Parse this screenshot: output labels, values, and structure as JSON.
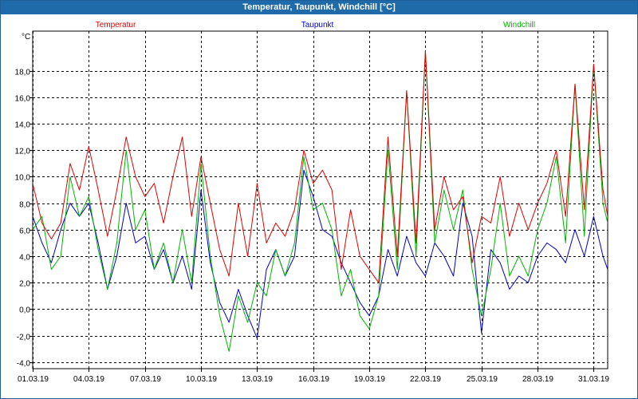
{
  "window": {
    "title": "Temperatur, Taupunkt, Windchill [°C]"
  },
  "chart_data": {
    "type": "line",
    "title": "Temperatur, Taupunkt, Windchill [°C]",
    "ylabel": "°C",
    "xlabel": "",
    "ylim": [
      -4.5,
      21.0
    ],
    "xlim": [
      0,
      30.75
    ],
    "grid": true,
    "legend_placement": "top",
    "x_ticks": [
      "01.03.19",
      "04.03.19",
      "07.03.19",
      "10.03.19",
      "13.03.19",
      "16.03.19",
      "19.03.19",
      "22.03.19",
      "25.03.19",
      "28.03.19",
      "31.03.19"
    ],
    "x_tick_days": [
      0,
      3,
      6,
      9,
      12,
      15,
      18,
      21,
      24,
      27,
      30
    ],
    "y_ticks": [
      "-4,0",
      "-2,0",
      "0,0",
      "2,0",
      "4,0",
      "6,0",
      "8,0",
      "10,0",
      "12,0",
      "14,0",
      "16,0",
      "18,0"
    ],
    "y_tick_values": [
      -4,
      -2,
      0,
      2,
      4,
      6,
      8,
      10,
      12,
      14,
      16,
      18
    ],
    "x_unit": "days since 01.03.19",
    "series": [
      {
        "name": "Temperatur",
        "color": "#e00000",
        "x": [
          0,
          0.5,
          1,
          1.5,
          2,
          2.5,
          3,
          3.5,
          4,
          4.5,
          5,
          5.5,
          6,
          6.5,
          7,
          7.5,
          8,
          8.5,
          9,
          9.5,
          10,
          10.5,
          11,
          11.5,
          12,
          12.5,
          13,
          13.5,
          14,
          14.5,
          15,
          15.5,
          16,
          16.5,
          17,
          17.5,
          18,
          18.5,
          19,
          19.5,
          20,
          20.5,
          21,
          21.5,
          22,
          22.5,
          23,
          23.5,
          24,
          24.5,
          25,
          25.5,
          26,
          26.5,
          27,
          27.5,
          28,
          28.5,
          29,
          29.5,
          30,
          30.5,
          30.75
        ],
        "values": [
          9.5,
          6.5,
          5.3,
          6.5,
          11,
          9,
          12.3,
          9,
          5.5,
          9,
          13,
          10,
          8.5,
          9.5,
          6.5,
          10,
          13,
          7,
          11.5,
          8,
          4.5,
          2.5,
          8,
          4,
          9.5,
          5,
          6.5,
          5.5,
          7.5,
          12,
          9.5,
          10.5,
          9,
          3,
          7.5,
          4,
          3,
          2,
          13,
          4,
          16.5,
          5,
          19.5,
          6,
          10,
          7.5,
          8.5,
          3.5,
          7,
          6.5,
          10,
          5.5,
          8,
          6,
          8,
          9.5,
          12,
          7,
          17,
          7.5,
          18.5,
          9,
          7
        ]
      },
      {
        "name": "Taupunkt",
        "color": "#0000c8",
        "x": [
          0,
          0.5,
          1,
          1.5,
          2,
          2.5,
          3,
          3.5,
          4,
          4.5,
          5,
          5.5,
          6,
          6.5,
          7,
          7.5,
          8,
          8.5,
          9,
          9.5,
          10,
          10.5,
          11,
          11.5,
          12,
          12.5,
          13,
          13.5,
          14,
          14.5,
          15,
          15.5,
          16,
          16.5,
          17,
          17.5,
          18,
          18.5,
          19,
          19.5,
          20,
          20.5,
          21,
          21.5,
          22,
          22.5,
          23,
          23.5,
          24,
          24.5,
          25,
          25.5,
          26,
          26.5,
          27,
          27.5,
          28,
          28.5,
          29,
          29.5,
          30,
          30.5,
          30.75
        ],
        "values": [
          7,
          5,
          3.5,
          6,
          8,
          7,
          8,
          5,
          1.5,
          4,
          8,
          5,
          5.5,
          3,
          4.5,
          2,
          4,
          1.5,
          9,
          3.5,
          0.5,
          -1,
          1.5,
          -0.5,
          -2.2,
          3,
          4.5,
          2.5,
          4,
          10.5,
          8.5,
          6,
          5.5,
          3.5,
          2,
          0.5,
          -0.5,
          1,
          4.5,
          2.5,
          5.5,
          3.5,
          2.5,
          5,
          4,
          2.5,
          8,
          5.5,
          -1.8,
          4.5,
          3.5,
          1.5,
          2.5,
          2,
          4,
          5,
          4.5,
          3.5,
          6,
          4,
          7,
          4,
          3
        ]
      },
      {
        "name": "Windchill",
        "color": "#00b400",
        "x": [
          0,
          0.5,
          1,
          1.5,
          2,
          2.5,
          3,
          3.5,
          4,
          4.5,
          5,
          5.5,
          6,
          6.5,
          7,
          7.5,
          8,
          8.5,
          9,
          9.5,
          10,
          10.5,
          11,
          11.5,
          12,
          12.5,
          13,
          13.5,
          14,
          14.5,
          15,
          15.5,
          16,
          16.5,
          17,
          17.5,
          18,
          18.5,
          19,
          19.5,
          20,
          20.5,
          21,
          21.5,
          22,
          22.5,
          23,
          23.5,
          24,
          24.5,
          25,
          25.5,
          26,
          26.5,
          27,
          27.5,
          28,
          28.5,
          29,
          29.5,
          30,
          30.5,
          30.75
        ],
        "values": [
          6,
          7,
          3,
          4,
          10,
          7,
          8.5,
          4.5,
          1.5,
          5,
          12,
          6,
          7.5,
          3,
          5,
          2,
          6,
          2,
          11,
          4,
          -0.5,
          -3.2,
          1,
          -1,
          2,
          1,
          4.5,
          2.5,
          5,
          11.5,
          7.5,
          8,
          6,
          1,
          3,
          -0.5,
          -1.5,
          1,
          12,
          3,
          16.5,
          4,
          19.5,
          5,
          9,
          6,
          9,
          3,
          -0.5,
          3,
          8,
          2.5,
          4,
          2.5,
          6,
          8,
          11.5,
          5,
          17,
          5.5,
          18.5,
          8,
          6.5
        ]
      }
    ]
  }
}
